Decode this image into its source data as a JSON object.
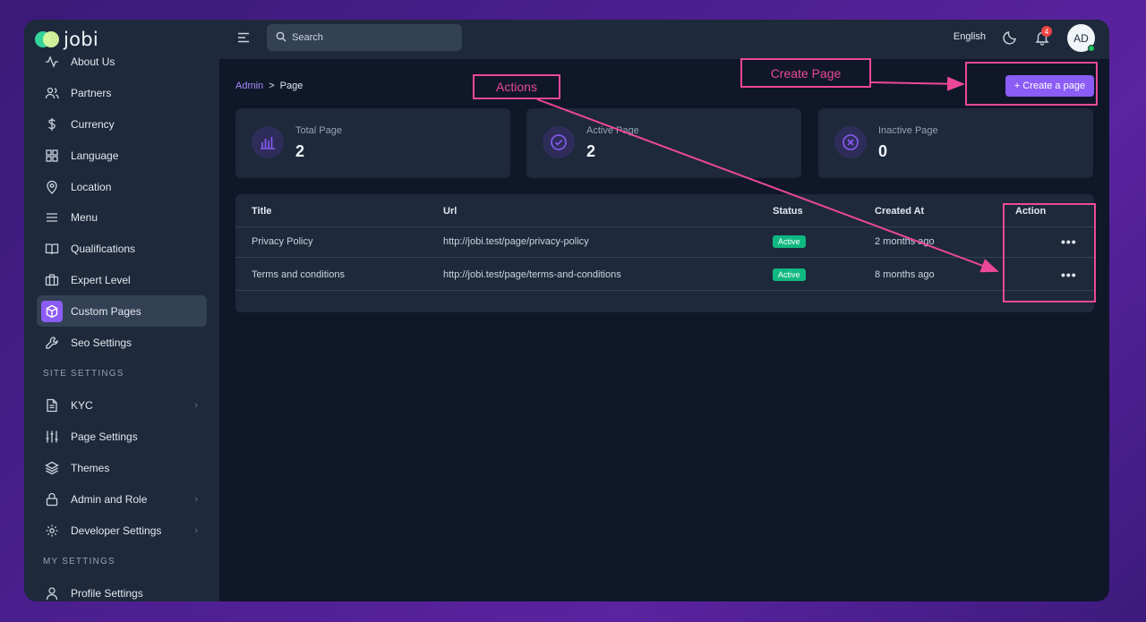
{
  "app": {
    "logo_text": "jobi"
  },
  "sidebar": {
    "items": [
      {
        "label": "About Us",
        "icon": "pulse-icon"
      },
      {
        "label": "Partners",
        "icon": "users-icon"
      },
      {
        "label": "Currency",
        "icon": "dollar-icon"
      },
      {
        "label": "Language",
        "icon": "grid-icon"
      },
      {
        "label": "Location",
        "icon": "map-pin-icon"
      },
      {
        "label": "Menu",
        "icon": "menu-icon"
      },
      {
        "label": "Qualifications",
        "icon": "book-icon"
      },
      {
        "label": "Expert Level",
        "icon": "briefcase-icon"
      },
      {
        "label": "Custom Pages",
        "icon": "cube-icon",
        "active": true
      },
      {
        "label": "Seo Settings",
        "icon": "wrench-icon"
      }
    ],
    "site_settings_title": "SITE SETTINGS",
    "site_items": [
      {
        "label": "KYC",
        "icon": "document-icon",
        "chevron": true
      },
      {
        "label": "Page Settings",
        "icon": "sliders-icon"
      },
      {
        "label": "Themes",
        "icon": "layers-icon"
      },
      {
        "label": "Admin and Role",
        "icon": "lock-icon",
        "chevron": true
      },
      {
        "label": "Developer Settings",
        "icon": "gear-icon",
        "chevron": true
      }
    ],
    "my_settings_title": "MY SETTINGS",
    "my_items": [
      {
        "label": "Profile Settings",
        "icon": "user-icon"
      }
    ]
  },
  "topbar": {
    "search_placeholder": "Search",
    "language": "English",
    "notification_count": "4",
    "avatar_initials": "AD"
  },
  "breadcrumb": {
    "parent": "Admin",
    "separator": ">",
    "current": "Page"
  },
  "create_button": {
    "label": "Create a page",
    "icon": "+"
  },
  "stats": [
    {
      "label": "Total Page",
      "value": "2",
      "icon": "chart-bars-icon"
    },
    {
      "label": "Active Page",
      "value": "2",
      "icon": "check-circle-icon"
    },
    {
      "label": "Inactive Page",
      "value": "0",
      "icon": "x-circle-icon"
    }
  ],
  "table": {
    "headers": {
      "title": "Title",
      "url": "Url",
      "status": "Status",
      "created": "Created At",
      "action": "Action"
    },
    "rows": [
      {
        "title": "Privacy Policy",
        "url": "http://jobi.test/page/privacy-policy",
        "status": "Active",
        "created": "2 months ago",
        "action": "•••"
      },
      {
        "title": "Terms and conditions",
        "url": "http://jobi.test/page/terms-and-conditions",
        "status": "Active",
        "created": "8 months ago",
        "action": "•••"
      }
    ]
  },
  "annotations": {
    "actions_label": "Actions",
    "create_label": "Create Page",
    "color": "#ec4899"
  },
  "colors": {
    "accent": "#8b5cf6",
    "success": "#10b981",
    "sidebar_bg": "#1e293b",
    "main_bg": "#0f1729"
  }
}
